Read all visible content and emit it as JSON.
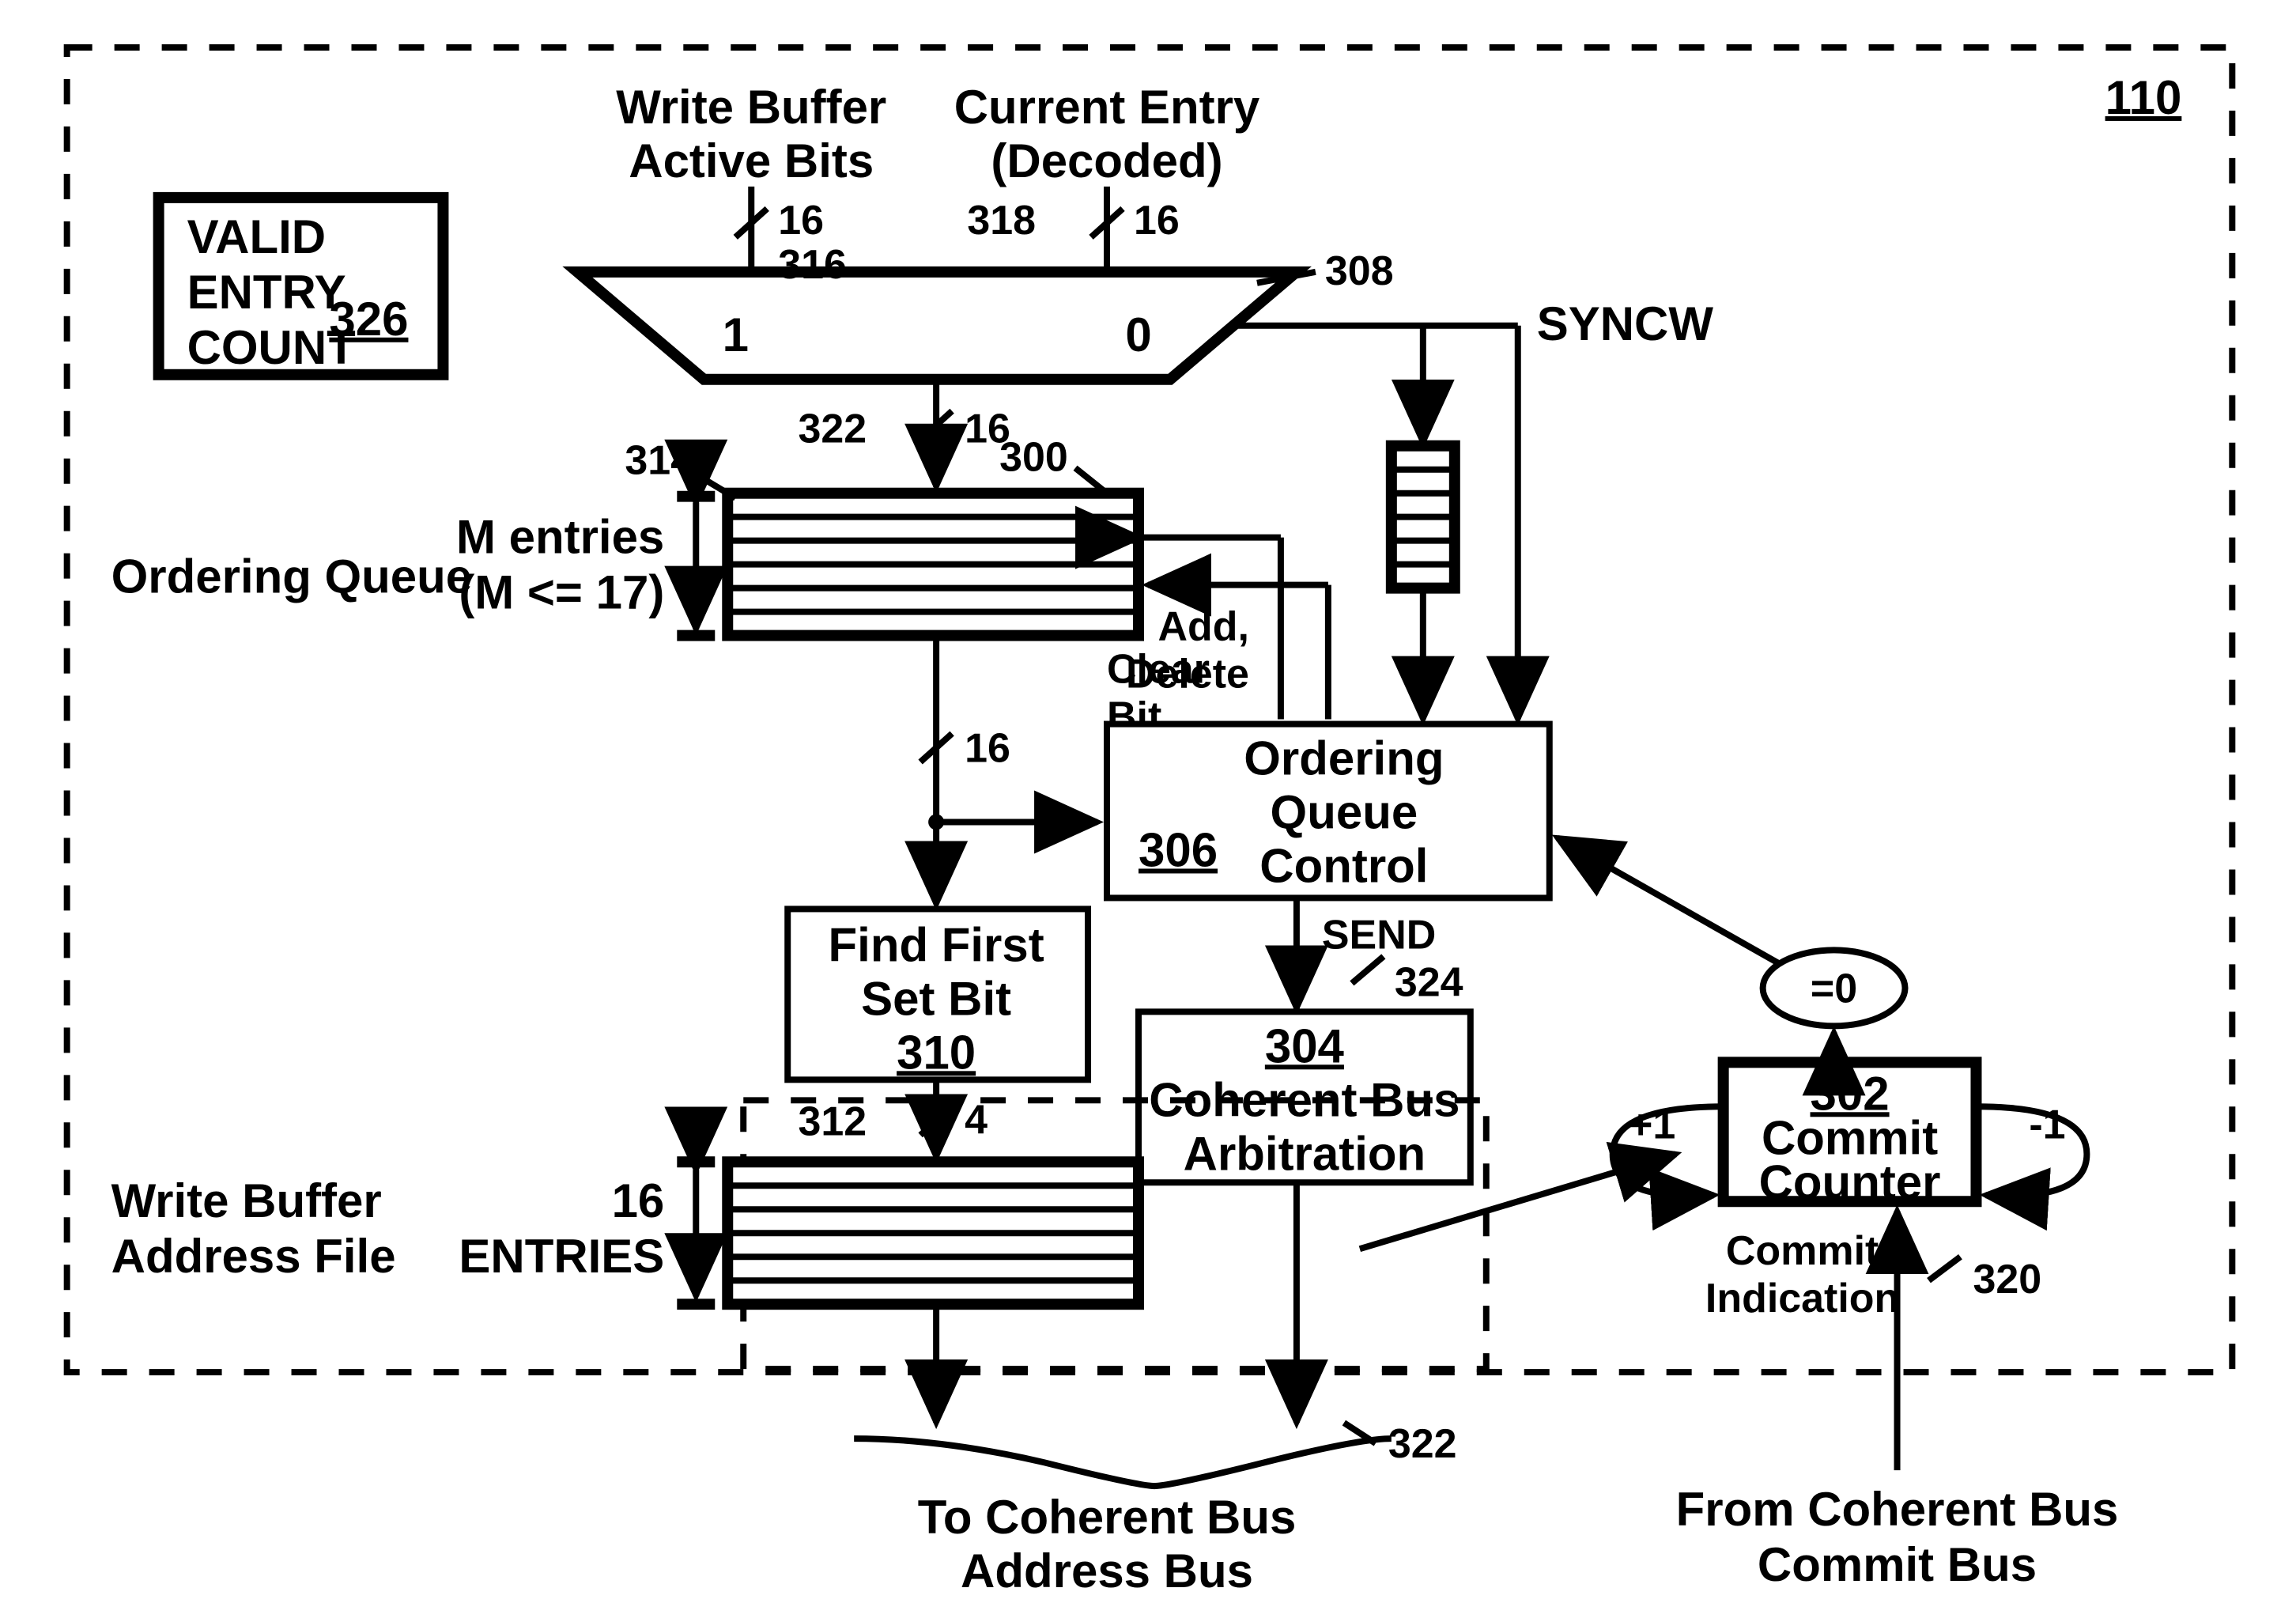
{
  "figure_ref": "110",
  "valid_entry_count": {
    "line1": "VALID",
    "line2": "ENTRY",
    "line3": "COUNT",
    "ref": "326"
  },
  "mux": {
    "input_left_label1": "Write Buffer",
    "input_left_label2": "Active Bits",
    "input_left_width": "16",
    "input_left_ref": "316",
    "input_right_label1": "Current Entry",
    "input_right_label2": "(Decoded)",
    "input_right_width": "16",
    "input_right_ref": "318",
    "sel_left": "1",
    "sel_right": "0",
    "ref": "308",
    "select_signal": "SYNCW",
    "out_width": "16",
    "out_ref": "322"
  },
  "ordering_queue": {
    "section_label": "Ordering Queue",
    "entries_label1": "M entries",
    "entries_label2": "(M <= 17)",
    "ref_314": "314",
    "ref_300": "300",
    "mid_width": "16",
    "clear_bit": "Clear",
    "clear_bit2": "Bit",
    "add_delete1": "Add,",
    "add_delete2": "Delete"
  },
  "oq_control": {
    "line1": "Ordering",
    "line2": "Queue",
    "line3": "Control",
    "ref": "306",
    "send": "SEND",
    "send_ref": "324"
  },
  "find_first": {
    "line1": "Find First",
    "line2": "Set Bit",
    "ref": "310",
    "out_width": "4",
    "out_ref": "312"
  },
  "write_buffer_file": {
    "section_label1": "Write Buffer",
    "section_label2": "Address File",
    "entries_label1": "16",
    "entries_label2": "ENTRIES"
  },
  "coherent_bus_arb": {
    "line1": "Coherent Bus",
    "line2": "Arbitration",
    "ref": "304"
  },
  "commit_counter": {
    "label1": "Commit",
    "label2": "Counter",
    "ref": "302",
    "plus": "+1",
    "minus": "-1",
    "eqzero": "=0"
  },
  "bottom": {
    "to_bus1": "To Coherent Bus",
    "to_bus2": "Address Bus",
    "to_bus_ref": "322",
    "commit_ind1": "Commit",
    "commit_ind2": "Indication",
    "commit_ind_ref": "320",
    "from_bus1": "From Coherent Bus",
    "from_bus2": "Commit Bus"
  }
}
